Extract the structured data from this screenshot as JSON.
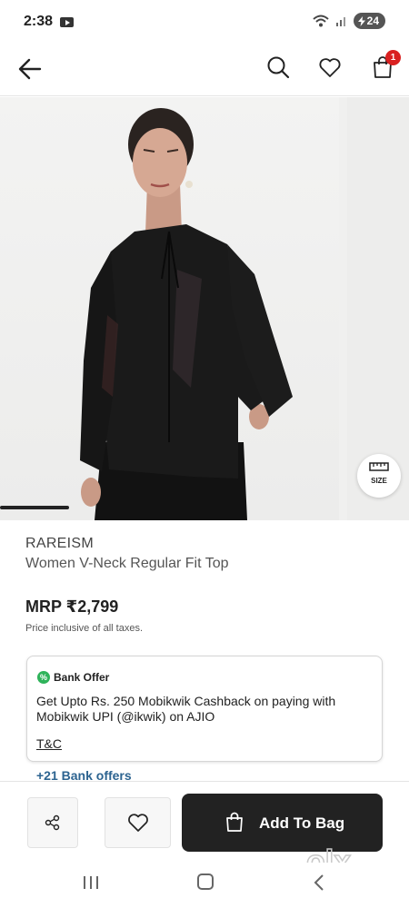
{
  "status_bar": {
    "time": "2:38",
    "battery": "24",
    "icons": [
      "youtube-icon",
      "wifi-icon",
      "signal-icon",
      "battery-charging-icon"
    ]
  },
  "header": {
    "icons": [
      "back-arrow-icon",
      "search-icon",
      "heart-icon",
      "shopping-bag-icon"
    ],
    "bag_count": "1"
  },
  "gallery": {
    "size_button_label": "SIZE",
    "current_image": 1
  },
  "product": {
    "brand": "RAREISM",
    "name": "Women V-Neck Regular Fit Top",
    "price": "MRP ₹2,799",
    "tax_note": "Price inclusive of all taxes."
  },
  "offer": {
    "badge": "%",
    "title": "Bank Offer",
    "text": "Get Upto Rs. 250 Mobikwik Cashback on paying with Mobikwik UPI (@ikwik) on AJIO",
    "tnc": "T&C",
    "more": "+21 Bank offers"
  },
  "actions": {
    "add_to_bag": "Add To Bag"
  },
  "watermark": {
    "text": "olx",
    "sub": "INDIA"
  },
  "colors": {
    "accent_dark": "#222222",
    "badge_red": "#d92121",
    "offer_green": "#2fb35a",
    "link_blue": "#2c6390"
  }
}
